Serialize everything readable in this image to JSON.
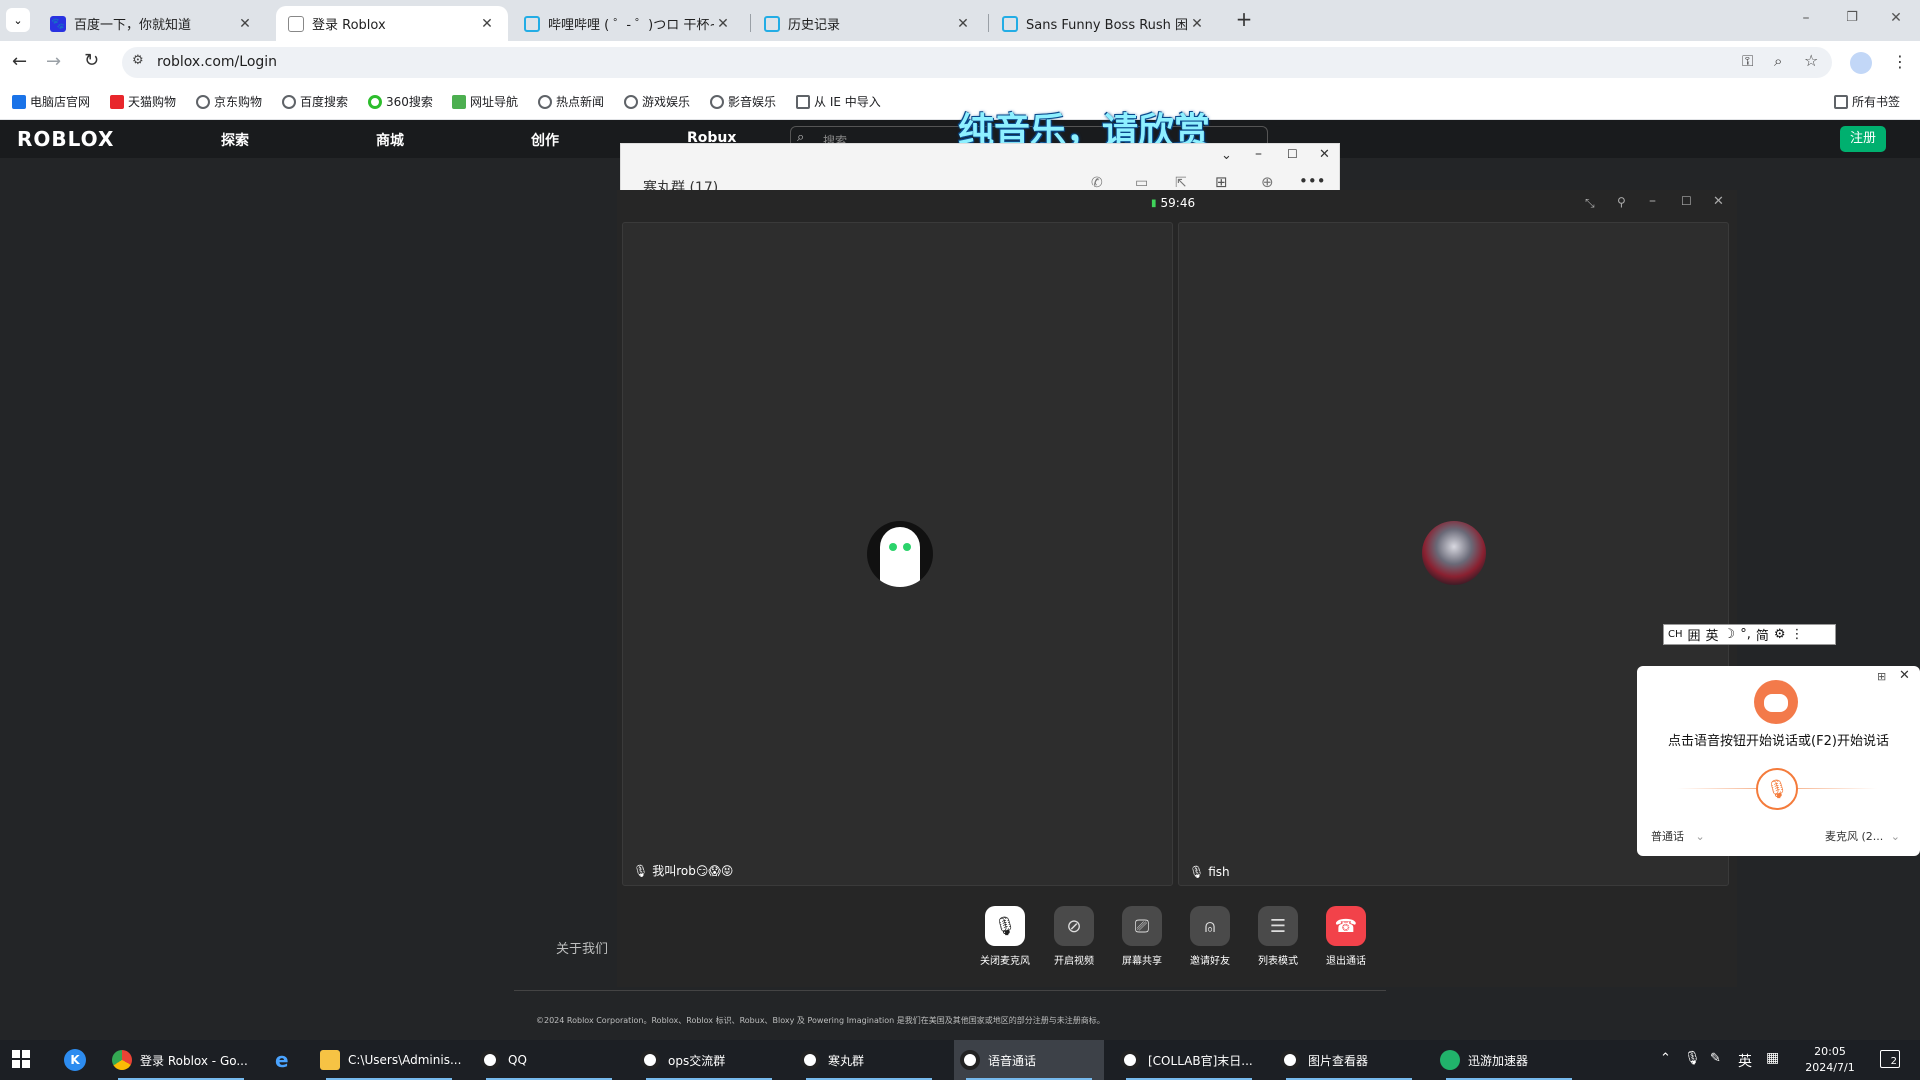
{
  "browser": {
    "tabs": [
      {
        "title": "百度一下，你就知道",
        "icon": "baidu-icon",
        "color": "#2932e1"
      },
      {
        "title": "登录 Roblox",
        "icon": "roblox-icon",
        "color": "#5f6368"
      },
      {
        "title": "哔哩哔哩 ( ゜- ゜)つロ 干杯~-bi",
        "icon": "bilibili-icon",
        "color": "#23ade5"
      },
      {
        "title": "历史记录",
        "icon": "bilibili-icon",
        "color": "#23ade5"
      },
      {
        "title": "Sans Funny Boss Rush 困难",
        "icon": "bilibili-icon",
        "color": "#23ade5"
      }
    ],
    "url": "roblox.com/Login",
    "bookmarks": [
      {
        "label": "电脑店官网",
        "color": "#1a73e8"
      },
      {
        "label": "天猫购物",
        "color": "#e8262b"
      },
      {
        "label": "京东购物",
        "color": "#5f6368"
      },
      {
        "label": "百度搜索",
        "color": "#5f6368"
      },
      {
        "label": "360搜索",
        "color": "#2cbd2c"
      },
      {
        "label": "网址导航",
        "color": "#4caf50"
      },
      {
        "label": "热点新闻",
        "color": "#5f6368"
      },
      {
        "label": "游戏娱乐",
        "color": "#5f6368"
      },
      {
        "label": "影音娱乐",
        "color": "#5f6368"
      },
      {
        "label": "从 IE 中导入",
        "color": "#5f6368"
      }
    ],
    "all_bookmarks": "所有书签"
  },
  "roblox": {
    "logo": "ROBLOX",
    "nav": [
      "探索",
      "商城",
      "创作",
      "Robux"
    ],
    "search_placeholder": "搜索",
    "signup": "注册",
    "about": "关于我们",
    "footer": "©2024 Roblox Corporation。Roblox、Roblox 标识、Robux、Bloxy 及 Powering Imagination 是我们在美国及其他国家或地区的部分注册与未注册商标。"
  },
  "overlay_caption": "纯音乐，请欣赏",
  "qq_group": {
    "title": "寒丸群 (17)"
  },
  "call": {
    "timer": "59:46",
    "participants": [
      {
        "name": "我叫rob😏😱😝"
      },
      {
        "name": "fish"
      }
    ],
    "controls": [
      {
        "label": "关闭麦克风",
        "icon": "microphone-icon"
      },
      {
        "label": "开启视频",
        "icon": "video-off-icon"
      },
      {
        "label": "屏幕共享",
        "icon": "screen-share-icon"
      },
      {
        "label": "邀请好友",
        "icon": "invite-friend-icon"
      },
      {
        "label": "列表模式",
        "icon": "list-mode-icon"
      },
      {
        "label": "退出通话",
        "icon": "hang-up-icon"
      }
    ]
  },
  "ime": {
    "items": [
      "CH",
      "囲",
      "英",
      "☽",
      "°,",
      "简",
      "⚙",
      "⋮"
    ]
  },
  "voice_panel": {
    "hint": "点击语音按钮开始说话或(F2)开始说话",
    "language": "普通话",
    "mic": "麦克风 (2..."
  },
  "taskbar": {
    "items": [
      {
        "label": "登录 Roblox - Go...",
        "color": "#4285f4"
      },
      {
        "label": "C:\\Users\\Adminis...",
        "color": "#f6c344"
      },
      {
        "label": "QQ",
        "color": "#ffffff"
      },
      {
        "label": "ops交流群",
        "color": "#ffffff"
      },
      {
        "label": "寒丸群",
        "color": "#ffffff"
      },
      {
        "label": "语音通话",
        "color": "#ffffff"
      },
      {
        "label": "[COLLAB官]末日...",
        "color": "#ffffff"
      },
      {
        "label": "图片查看器",
        "color": "#ffffff"
      },
      {
        "label": "迅游加速器",
        "color": "#21b36b"
      }
    ],
    "tray_lang": "英",
    "time": "20:05",
    "date": "2024/7/1",
    "notification_count": "2"
  }
}
